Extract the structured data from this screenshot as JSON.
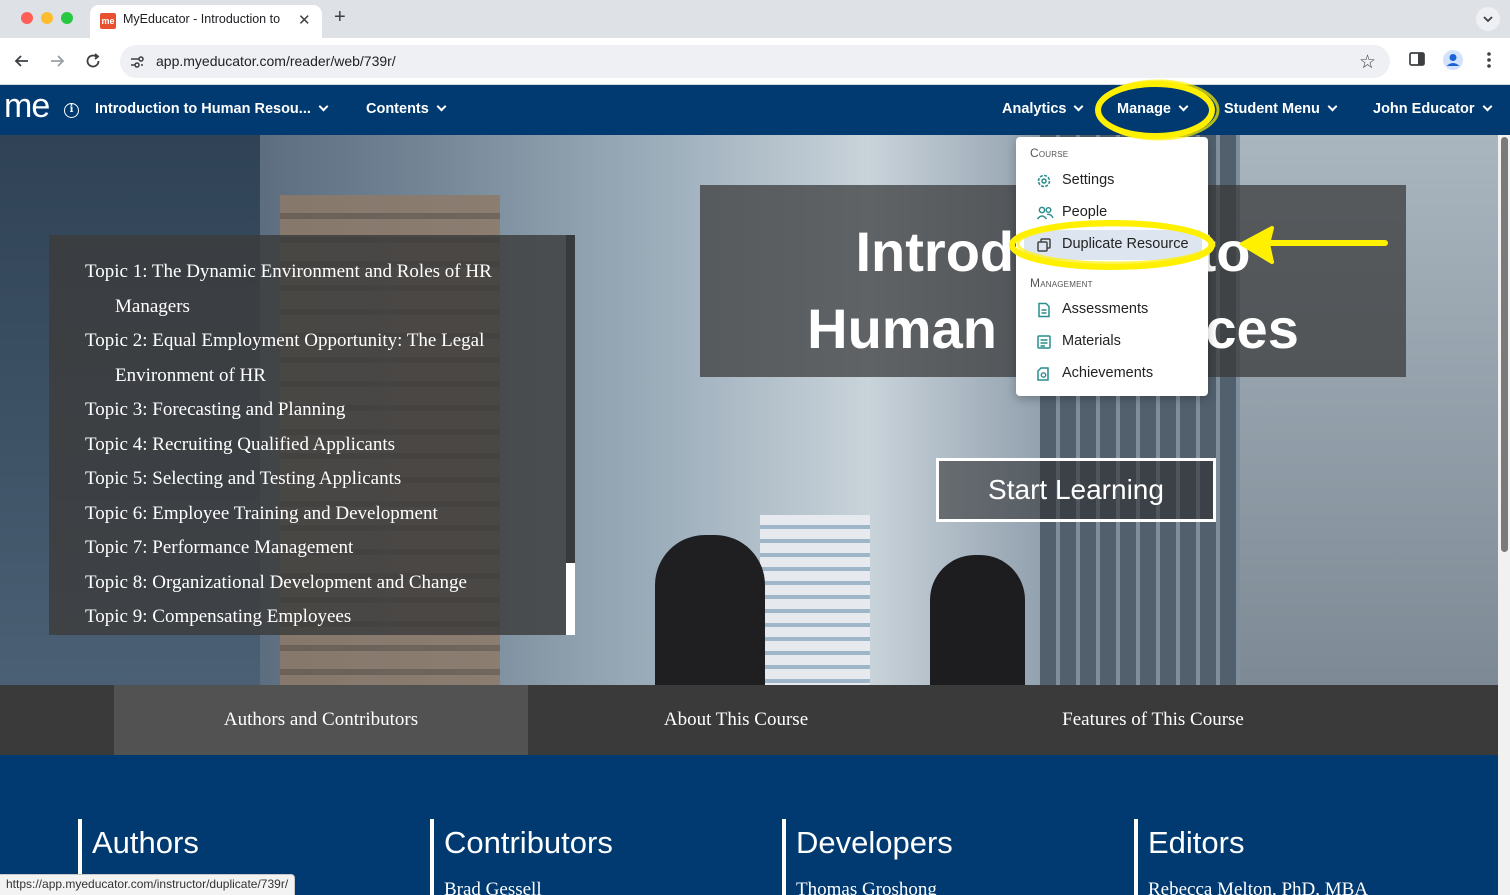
{
  "browser": {
    "tab_title": "MyEducator - Introduction to Human Resources",
    "favicon_text": "me",
    "url": "app.myeducator.com/reader/web/739r/",
    "status_url": "https://app.myeducator.com/instructor/duplicate/739r/"
  },
  "nav": {
    "logo": "me",
    "course_title": "Introduction to Human Resou...",
    "contents": "Contents",
    "analytics": "Analytics",
    "manage": "Manage",
    "student_menu": "Student Menu",
    "user": "John Educator",
    "brand_color": "#003a70"
  },
  "hero": {
    "topics": [
      "Topic 1: The Dynamic Environment and Roles of HR Managers",
      "Topic 2: Equal Employment Opportunity: The Legal Environment of HR",
      "Topic 3: Forecasting and Planning",
      "Topic 4: Recruiting Qualified Applicants",
      "Topic 5: Selecting and Testing Applicants",
      "Topic 6: Employee Training and Development",
      "Topic 7: Performance Management",
      "Topic 8: Organizational Development and Change",
      "Topic 9: Compensating Employees"
    ],
    "title_line1": "Introduction to",
    "title_line2": "Human Resources",
    "start_button": "Start Learning"
  },
  "sections": {
    "tabs": [
      "Authors and Contributors",
      "About This Course",
      "Features of This Course"
    ],
    "active": 0
  },
  "credits": [
    {
      "heading": "Authors",
      "name": ""
    },
    {
      "heading": "Contributors",
      "name": "Brad Gessell"
    },
    {
      "heading": "Developers",
      "name": "Thomas Groshong"
    },
    {
      "heading": "Editors",
      "name": "Rebecca Melton, PhD, MBA"
    }
  ],
  "manage_menu": {
    "course_heading": "Course",
    "management_heading": "Management",
    "items": [
      {
        "label": "Settings",
        "icon": "gear-icon"
      },
      {
        "label": "People",
        "icon": "people-icon"
      },
      {
        "label": "Duplicate Resource",
        "icon": "duplicate-icon"
      },
      {
        "label": "Assessments",
        "icon": "document-icon"
      },
      {
        "label": "Materials",
        "icon": "materials-icon"
      },
      {
        "label": "Achievements",
        "icon": "achievement-icon"
      }
    ],
    "icon_color": "#2a8c8c",
    "highlight_color": "#fff000"
  }
}
